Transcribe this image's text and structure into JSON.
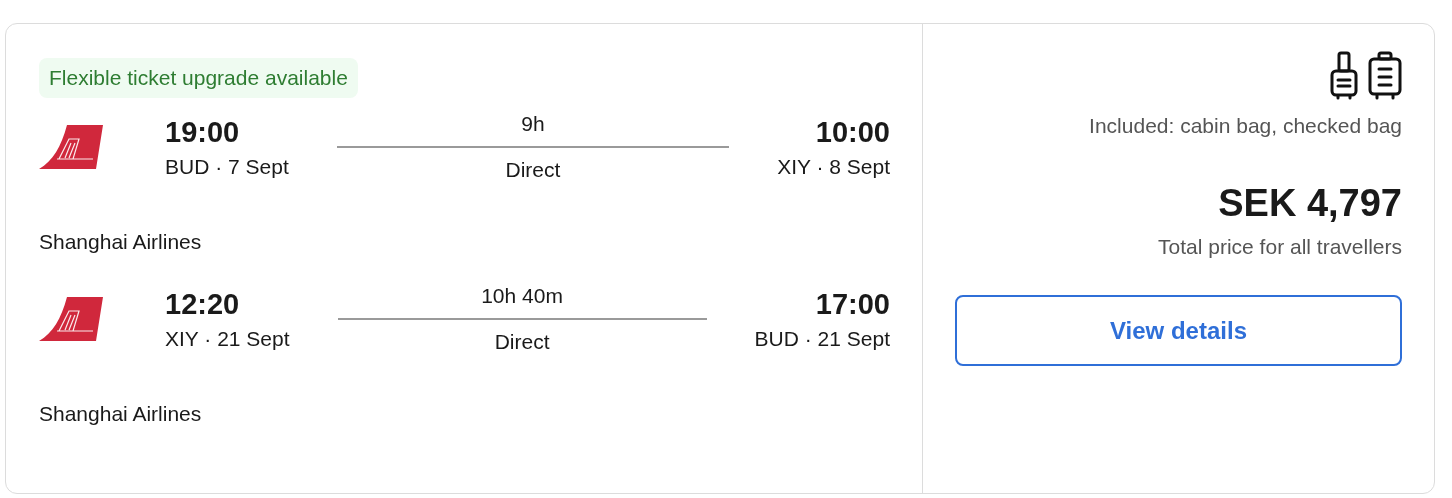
{
  "badge": "Flexible ticket upgrade available",
  "legs": [
    {
      "departure_time": "19:00",
      "departure": "BUD · 7 Sept",
      "duration": "9h",
      "stops": "Direct",
      "arrival_time": "10:00",
      "arrival": "XIY · 8 Sept",
      "airline": "Shanghai Airlines"
    },
    {
      "departure_time": "12:20",
      "departure": "XIY · 21 Sept",
      "duration": "10h 40m",
      "stops": "Direct",
      "arrival_time": "17:00",
      "arrival": "BUD · 21 Sept",
      "airline": "Shanghai Airlines"
    }
  ],
  "included": "Included: cabin bag, checked bag",
  "price": "SEK 4,797",
  "price_note": "Total price for all travellers",
  "button": "View details"
}
